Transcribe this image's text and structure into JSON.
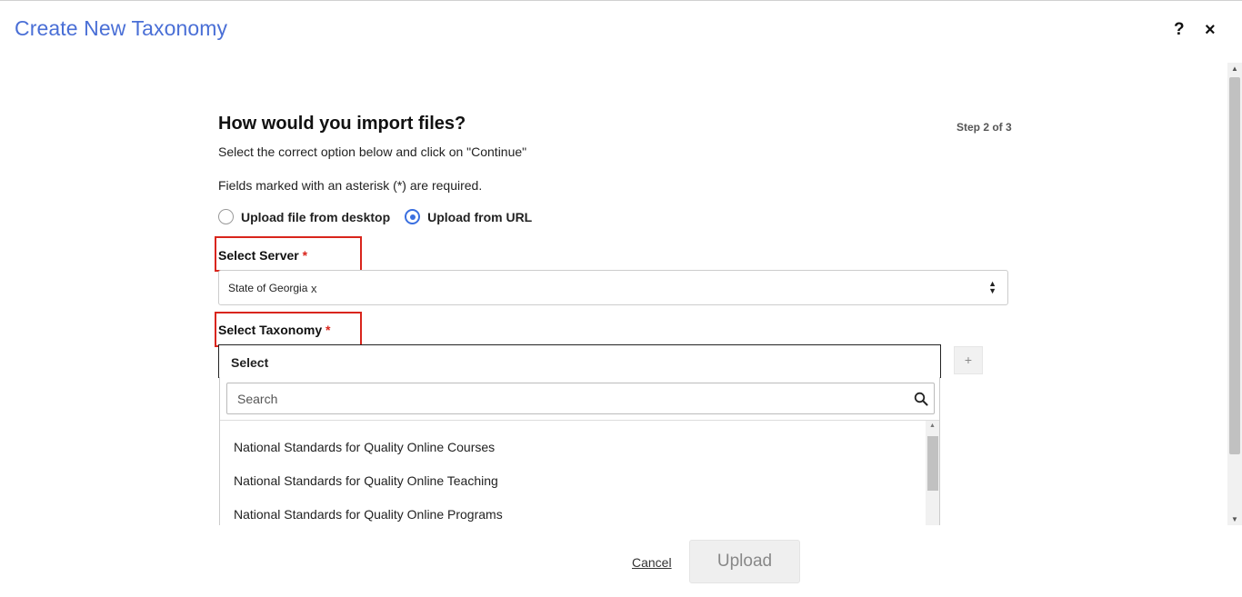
{
  "dialog": {
    "title": "Create New Taxonomy",
    "help_label": "?",
    "close_label": "×"
  },
  "form": {
    "heading": "How would you import files?",
    "step": "Step 2 of 3",
    "instructions": "Select the correct option below and click on \"Continue\"",
    "required_note": "Fields marked with an asterisk (*) are required.",
    "import_options": [
      {
        "label": "Upload file from desktop",
        "checked": false
      },
      {
        "label": "Upload from URL",
        "checked": true
      }
    ],
    "server": {
      "label": "Select Server",
      "required_mark": "*",
      "selected_value": "State of Georgia",
      "remove_label": "x"
    },
    "taxonomy": {
      "label": "Select Taxonomy",
      "required_mark": "*",
      "selected_value": "Select",
      "add_label": "+",
      "search_placeholder": "Search",
      "options": [
        "National Standards for Quality Online Courses",
        "National Standards for Quality Online Teaching",
        "National Standards for Quality Online Programs"
      ]
    }
  },
  "footer": {
    "cancel_label": "Cancel",
    "upload_label": "Upload"
  },
  "colors": {
    "title": "#4a6fd6",
    "highlight_box": "#d9251c",
    "radio_active": "#3a6fe0"
  }
}
